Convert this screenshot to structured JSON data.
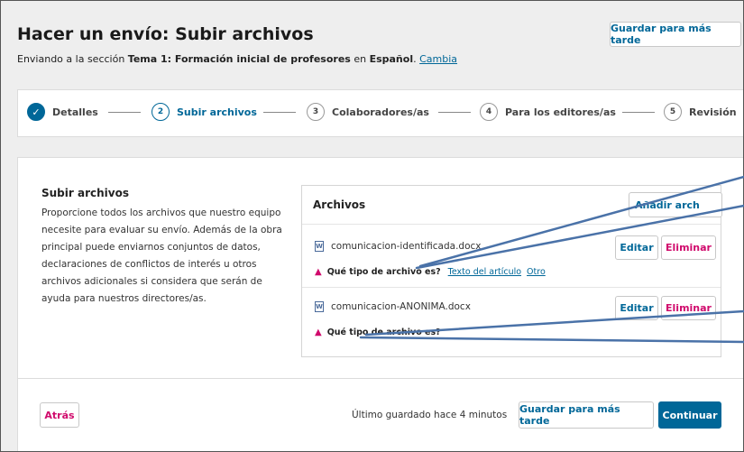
{
  "header": {
    "title": "Hacer un envío: Subir archivos",
    "subtitle_prefix": "Enviando a la sección ",
    "section": "Tema 1: Formación inicial de profesores",
    "subtitle_mid": " en ",
    "language": "Español",
    "subtitle_end": ".",
    "change_link": "Cambia",
    "save_later": "Guardar para más tarde"
  },
  "steps": [
    {
      "num": "✓",
      "label": "Detalles"
    },
    {
      "num": "2",
      "label": "Subir archivos"
    },
    {
      "num": "3",
      "label": "Colaboradores/as"
    },
    {
      "num": "4",
      "label": "Para los editores/as"
    },
    {
      "num": "5",
      "label": "Revisión"
    }
  ],
  "upload": {
    "title": "Subir archivos",
    "description": "Proporcione todos los archivos que nuestro equipo necesite para evaluar su envío. Además de la obra principal puede enviarnos conjuntos de datos, declaraciones de conflictos de interés u otros archivos adicionales si considera que serán de ayuda para nuestros directores/as."
  },
  "files_panel": {
    "title": "Archivos",
    "add_button": "Añadir arch",
    "files": [
      {
        "name": "comunicacion-identificada.docx",
        "edit": "Editar",
        "delete": "Eliminar",
        "question": "Qué tipo de archivo es?",
        "opt1": "Texto del artículo",
        "opt2": "Otro"
      },
      {
        "name": "comunicacion-ANONIMA.docx",
        "edit": "Editar",
        "delete": "Eliminar",
        "question": "Qué tipo de archivo es?"
      }
    ]
  },
  "footer": {
    "back": "Atrás",
    "saved": "Último guardado hace 4 minutos",
    "save_later": "Guardar para más tarde",
    "continue": "Continuar"
  },
  "colors": {
    "primary": "#006798",
    "danger": "#d00a6c",
    "annotation": "#4a72a8"
  }
}
